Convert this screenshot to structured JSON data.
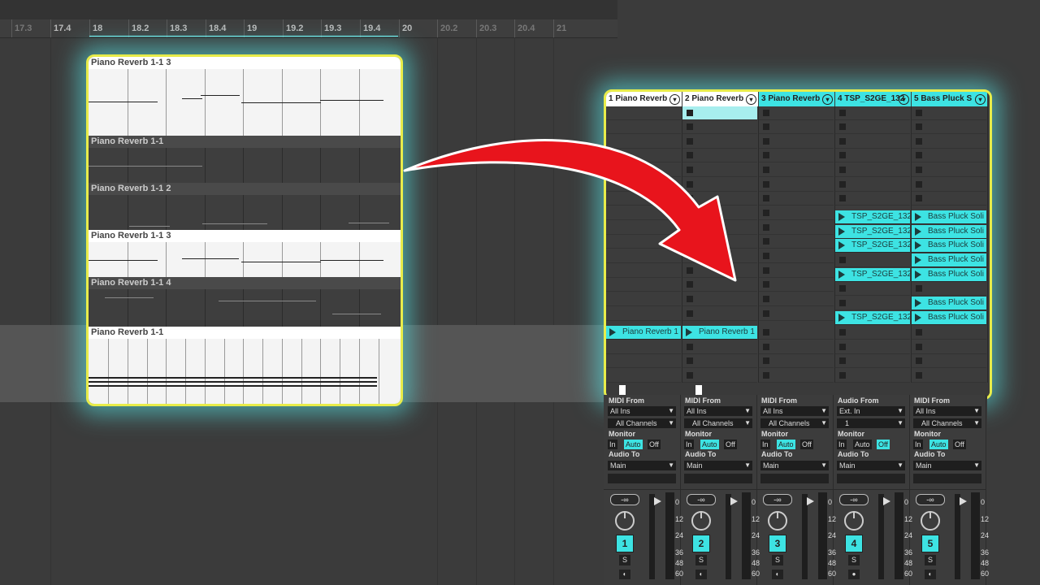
{
  "ruler": {
    "ticks": [
      "17.3",
      "17.4",
      "18",
      "18.2",
      "18.3",
      "18.4",
      "19",
      "19.2",
      "19.3",
      "19.4",
      "20",
      "20.2",
      "20.3",
      "20.4",
      "21"
    ]
  },
  "arrangement": {
    "lanes": [
      {
        "title": "Piano Reverb 1-1 3"
      },
      {
        "title": "Piano Reverb 1-1"
      },
      {
        "title": "Piano Reverb 1-1 2"
      },
      {
        "title": "Piano Reverb 1-1 3"
      },
      {
        "title": "Piano Reverb 1-1 4"
      },
      {
        "title": "Piano Reverb 1-1"
      }
    ]
  },
  "session": {
    "tracks": [
      {
        "name": "1 Piano Reverb",
        "color": "#ffffff"
      },
      {
        "name": "2 Piano Reverb",
        "color": "#ffffff"
      },
      {
        "name": "3 Piano Reverb",
        "color": "#3de3e3"
      },
      {
        "name": "4 TSP_S2GE_132",
        "color": "#3de3e3"
      },
      {
        "name": "5 Bass Pluck S",
        "color": "#3de3e3"
      }
    ],
    "clips": {
      "piano_reverb_1": "Piano Reverb 1",
      "tsp": "TSP_S2GE_132",
      "bass": "Bass Pluck Soli"
    }
  },
  "mixer": {
    "labels": {
      "midi_from": "MIDI From",
      "audio_from": "Audio From",
      "all_ins": "All Ins",
      "ext_in": "Ext. In",
      "all_channels": "All Channels",
      "one": "1",
      "monitor": "Monitor",
      "in": "In",
      "auto": "Auto",
      "off": "Off",
      "audio_to": "Audio To",
      "main": "Main",
      "neg_inf": "-∞",
      "solo": "S"
    },
    "scale": [
      "0",
      "12",
      "24",
      "36",
      "48",
      "60"
    ],
    "track_numbers": [
      "1",
      "2",
      "3",
      "4",
      "5"
    ]
  },
  "colors": {
    "accent": "#3de3e3",
    "highlight_border": "#e8ec4a",
    "arrow": "#e8141c"
  }
}
